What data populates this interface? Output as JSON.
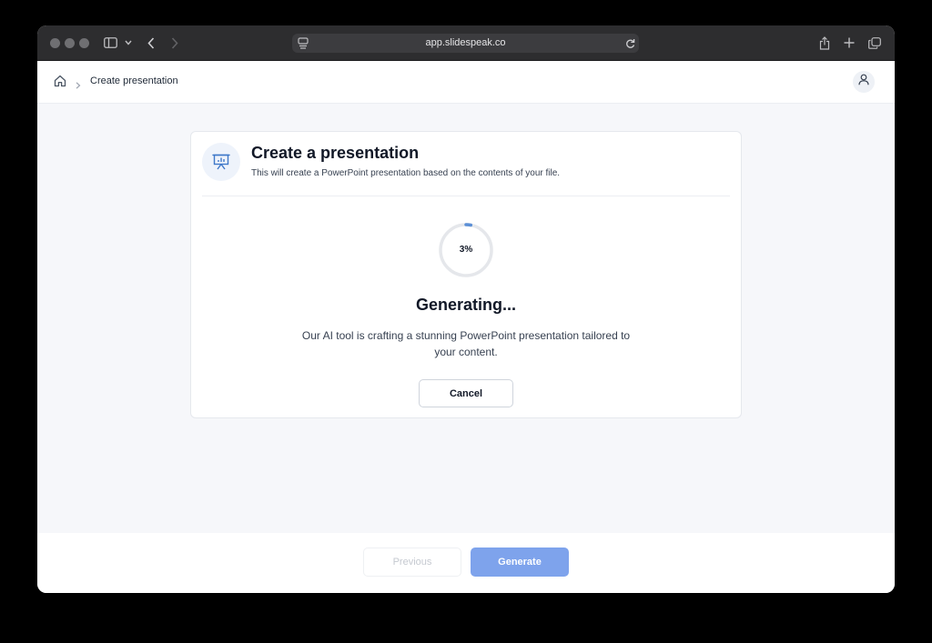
{
  "browser": {
    "url": "app.slidespeak.co",
    "controls": {
      "close": "close-window",
      "minimize": "minimize-window",
      "zoom": "zoom-window"
    }
  },
  "breadcrumb": {
    "home_icon": "home-icon",
    "current": "Create presentation"
  },
  "card": {
    "icon": "presentation-board-icon",
    "title": "Create a presentation",
    "subtitle": "This will create a PowerPoint presentation based on the contents of your file."
  },
  "progress": {
    "value": 0.03,
    "label": "3%"
  },
  "status": {
    "title": "Generating...",
    "description": "Our AI tool is crafting a stunning PowerPoint presentation tailored to your content."
  },
  "buttons": {
    "cancel": "Cancel",
    "previous": "Previous",
    "generate": "Generate"
  },
  "colors": {
    "accent": "#5b8fd6",
    "generate_button": "#7ea3ec",
    "ring_track": "#e5e7eb"
  }
}
